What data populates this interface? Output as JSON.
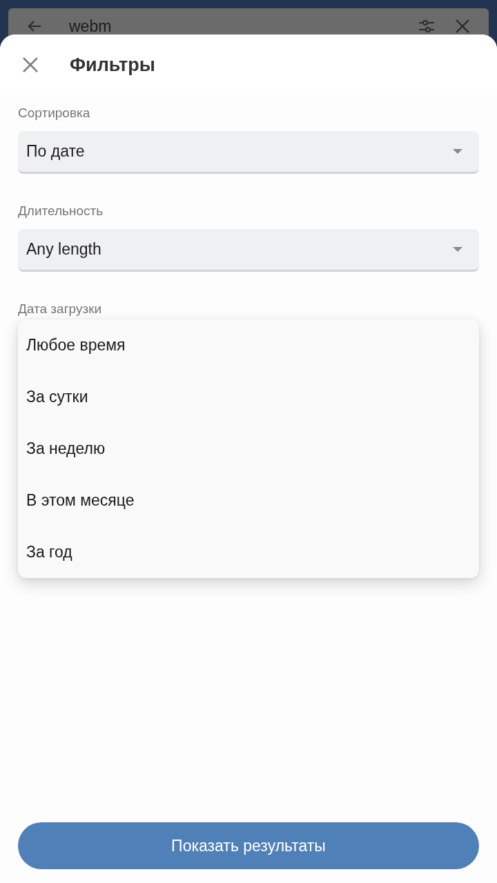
{
  "search_bar": {
    "value": "webm"
  },
  "sheet": {
    "title": "Фильтры"
  },
  "filters": [
    {
      "label": "Сортировка",
      "value": "По дате",
      "expanded": false
    },
    {
      "label": "Длительность",
      "value": "Any length",
      "expanded": false
    },
    {
      "label": "Дата загрузки",
      "expanded": true,
      "options": [
        {
          "label": "Любое время",
          "selected": false
        },
        {
          "label": "За сутки",
          "selected": false
        },
        {
          "label": "За неделю",
          "selected": false
        },
        {
          "label": "В этом месяце",
          "selected": false
        },
        {
          "label": "За год",
          "selected": false
        }
      ]
    }
  ],
  "apply_button": "Показать результаты"
}
